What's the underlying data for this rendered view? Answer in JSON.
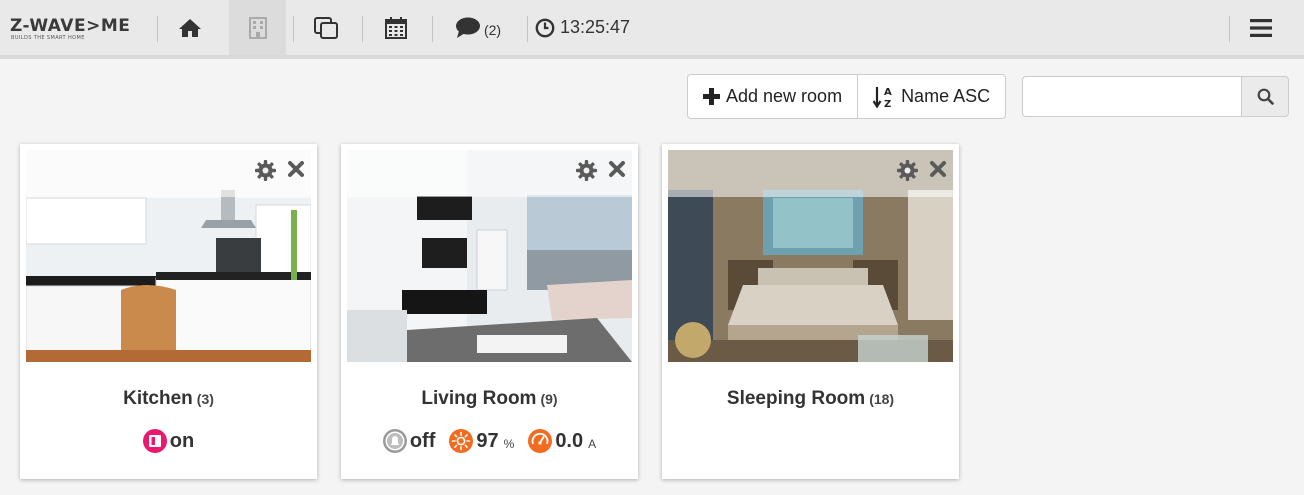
{
  "brand": {
    "logo_text": "Z-WAVE>ME",
    "logo_tagline": "BUILDS THE SMART HOME"
  },
  "nav": {
    "home_icon": "home-icon",
    "rooms_icon": "building-icon",
    "elements_icon": "copy-icon",
    "events_icon": "calendar-icon",
    "messages_icon": "comment-icon",
    "messages_count": "(2)",
    "clock_icon": "clock-icon",
    "clock_time": "13:25:47",
    "menu_icon": "hamburger-icon",
    "active_color": "#dcdcdc"
  },
  "toolbar": {
    "add_room_label": "Add new room",
    "sort_label": "Name ASC",
    "search_placeholder": "",
    "search_value": ""
  },
  "rooms": [
    {
      "name": "Kitchen",
      "count": "(3)",
      "image": "kitchen-photo",
      "widgets": [
        {
          "icon": "switch-icon",
          "color": "#e8196e",
          "value": "on",
          "unit": ""
        }
      ]
    },
    {
      "name": "Living Room",
      "count": "(9)",
      "image": "living-room-photo",
      "widgets": [
        {
          "icon": "bell-icon",
          "color": "#9a9a9a",
          "value": "off",
          "unit": ""
        },
        {
          "icon": "sun-icon",
          "color": "#f26b1f",
          "value": "97",
          "unit": "%"
        },
        {
          "icon": "gauge-icon",
          "color": "#f26b1f",
          "value": "0.0",
          "unit": "A"
        }
      ]
    },
    {
      "name": "Sleeping Room",
      "count": "(18)",
      "image": "bedroom-photo",
      "widgets": []
    }
  ]
}
